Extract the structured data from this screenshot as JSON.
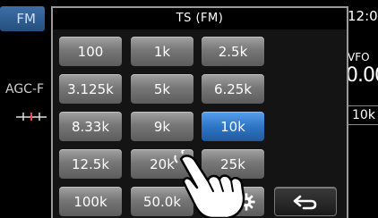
{
  "background": {
    "left_tab": "FM",
    "agc_label": "AGC-F",
    "clock": "12:0",
    "vfo_label": "VFO",
    "vfo_digits": "0.00",
    "side_button": "10k"
  },
  "dialog": {
    "title": "TS (FM)",
    "buttons": [
      [
        "100",
        "1k",
        "2.5k"
      ],
      [
        "3.125k",
        "5k",
        "6.25k"
      ],
      [
        "8.33k",
        "9k",
        "10k"
      ],
      [
        "12.5k",
        "20k",
        "25k"
      ],
      [
        "100k",
        "50.0k"
      ]
    ],
    "selected": "10k",
    "gear_icon": "gear-icon",
    "back_icon": "return-arrow-icon"
  },
  "colors": {
    "selected_button": "#2f76c7",
    "button": "#777777",
    "dialog_bg": "#141414"
  }
}
